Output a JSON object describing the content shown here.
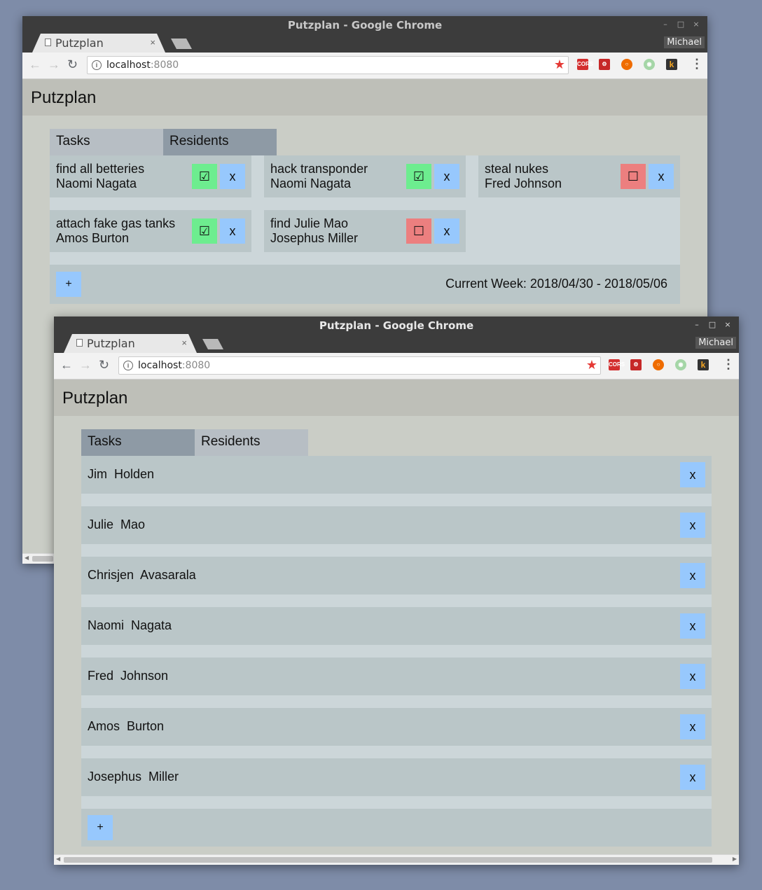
{
  "colors": {
    "desktop": "#7e8ca8",
    "done": "#6ded8f",
    "undone": "#ec7f7f",
    "action": "#97c8fd"
  },
  "window1": {
    "title": "Putzplan - Google Chrome",
    "controls": {
      "minimize": "–",
      "maximize": "□",
      "close": "×"
    },
    "tab": {
      "label": "Putzplan",
      "close": "×"
    },
    "profile": "Michael",
    "url": {
      "host": "localhost",
      "port": ":8080"
    },
    "app": {
      "title": "Putzplan",
      "tabs": [
        {
          "label": "Tasks"
        },
        {
          "label": "Residents"
        }
      ],
      "active_tab": "Tasks",
      "tasks": [
        {
          "title": "find all betteries",
          "assignee": "Naomi Nagata",
          "done": true,
          "toggle": "☑",
          "delete": "x"
        },
        {
          "title": "hack transponder",
          "assignee": "Naomi Nagata",
          "done": true,
          "toggle": "☑",
          "delete": "x"
        },
        {
          "title": "steal nukes",
          "assignee": "Fred Johnson",
          "done": false,
          "toggle": "☐",
          "delete": "x"
        },
        {
          "title": "attach fake gas tanks",
          "assignee": "Amos Burton",
          "done": true,
          "toggle": "☑",
          "delete": "x"
        },
        {
          "title": "find Julie Mao",
          "assignee": "Josephus Miller",
          "done": false,
          "toggle": "☐",
          "delete": "x"
        }
      ],
      "add_label": "+",
      "current_week": "Current Week: 2018/04/30 - 2018/05/06"
    }
  },
  "window2": {
    "title": "Putzplan - Google Chrome",
    "controls": {
      "minimize": "–",
      "maximize": "□",
      "close": "×"
    },
    "tab": {
      "label": "Putzplan",
      "close": "×"
    },
    "profile": "Michael",
    "url": {
      "host": "localhost",
      "port": ":8080"
    },
    "app": {
      "title": "Putzplan",
      "tabs": [
        {
          "label": "Tasks"
        },
        {
          "label": "Residents"
        }
      ],
      "active_tab": "Residents",
      "residents": [
        {
          "name": "Jim  Holden",
          "delete": "x"
        },
        {
          "name": "Julie  Mao",
          "delete": "x"
        },
        {
          "name": "Chrisjen  Avasarala",
          "delete": "x"
        },
        {
          "name": "Naomi  Nagata",
          "delete": "x"
        },
        {
          "name": "Fred  Johnson",
          "delete": "x"
        },
        {
          "name": "Amos  Burton",
          "delete": "x"
        },
        {
          "name": "Josephus  Miller",
          "delete": "x"
        }
      ],
      "add_label": "+"
    }
  }
}
